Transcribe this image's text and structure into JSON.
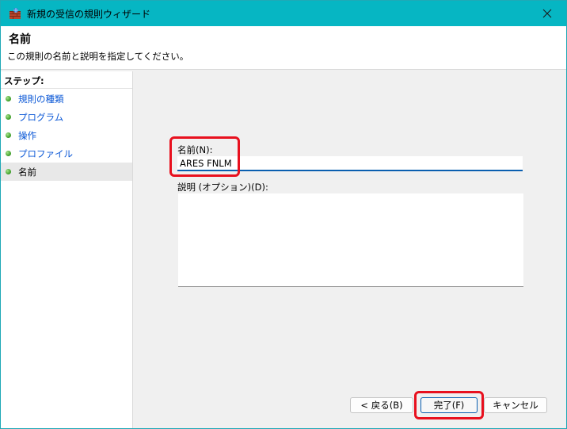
{
  "window": {
    "title": "新規の受信の規則ウィザード",
    "icon": "firewall-rule-icon",
    "close_symbol": "✕"
  },
  "header": {
    "title": "名前",
    "description": "この規則の名前と説明を指定してください。"
  },
  "sidebar": {
    "steps_label": "ステップ:",
    "steps": [
      {
        "label": "規則の種類",
        "state": "done"
      },
      {
        "label": "プログラム",
        "state": "done"
      },
      {
        "label": "操作",
        "state": "done"
      },
      {
        "label": "プロファイル",
        "state": "done"
      },
      {
        "label": "名前",
        "state": "current"
      }
    ]
  },
  "form": {
    "name_label": "名前(N):",
    "name_value": "ARES FNLM",
    "description_label": "説明 (オプション)(D):",
    "description_value": ""
  },
  "buttons": {
    "back": "< 戻る(B)",
    "finish": "完了(F)",
    "cancel": "キャンセル"
  },
  "colors": {
    "titlebar": "#06b6c3",
    "highlight": "#e8101e",
    "link": "#0a57d6",
    "focus": "#0a5fb0"
  }
}
